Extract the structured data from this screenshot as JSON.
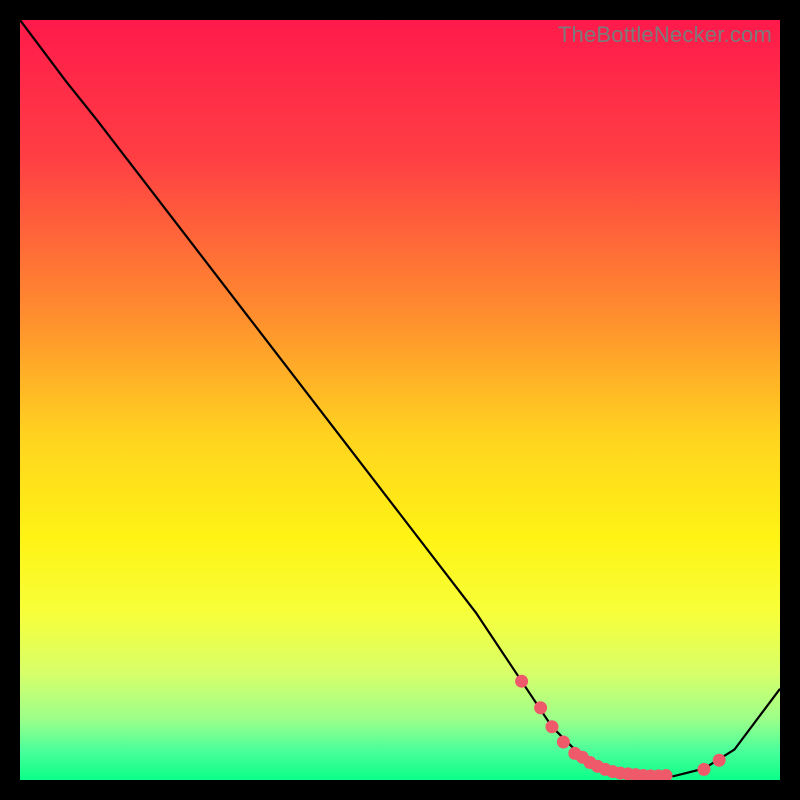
{
  "watermark": "TheBottleNecker.com",
  "chart_data": {
    "type": "line",
    "title": "",
    "xlabel": "",
    "ylabel": "",
    "xlim": [
      0,
      100
    ],
    "ylim": [
      0,
      100
    ],
    "background_gradient": {
      "stops": [
        {
          "offset": 0,
          "color": "#ff1a4b"
        },
        {
          "offset": 18,
          "color": "#ff3e44"
        },
        {
          "offset": 38,
          "color": "#ff8a2f"
        },
        {
          "offset": 55,
          "color": "#ffd41f"
        },
        {
          "offset": 68,
          "color": "#fff314"
        },
        {
          "offset": 78,
          "color": "#f7ff3a"
        },
        {
          "offset": 86,
          "color": "#d7ff6a"
        },
        {
          "offset": 92,
          "color": "#9cff8a"
        },
        {
          "offset": 96,
          "color": "#4dff9a"
        },
        {
          "offset": 100,
          "color": "#0bff89"
        }
      ]
    },
    "series": [
      {
        "name": "bottleneck-curve",
        "color": "#000000",
        "x": [
          0,
          6,
          10,
          20,
          30,
          40,
          50,
          60,
          66,
          70,
          74,
          78,
          82,
          86,
          90,
          94,
          100
        ],
        "y": [
          100,
          92,
          87,
          74,
          61,
          48,
          35,
          22,
          13,
          7,
          3,
          1,
          0.5,
          0.5,
          1.5,
          4,
          12
        ]
      }
    ],
    "markers": {
      "name": "optimal-range-points",
      "color": "#ef5a6b",
      "radius": 6.5,
      "x": [
        66,
        68.5,
        70,
        71.5,
        73,
        74,
        75,
        76,
        77,
        78,
        79,
        80,
        81,
        82,
        83,
        84,
        85,
        90,
        92
      ],
      "y": [
        13,
        9.5,
        7,
        5,
        3.5,
        3,
        2.3,
        1.8,
        1.4,
        1.1,
        0.9,
        0.8,
        0.7,
        0.6,
        0.55,
        0.55,
        0.6,
        1.4,
        2.6
      ]
    }
  }
}
